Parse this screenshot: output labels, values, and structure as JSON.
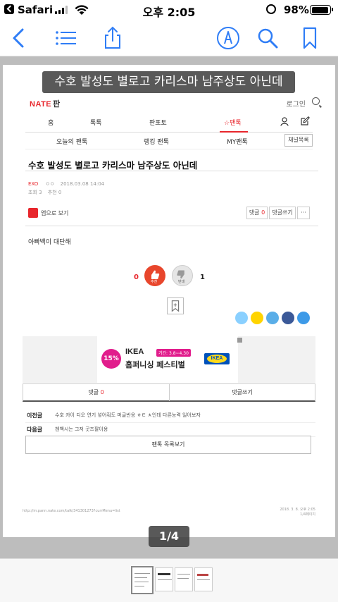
{
  "status_bar": {
    "carrier": "Safari",
    "time": "오후 2:05",
    "battery_percent": "98%",
    "signal_bars": 3
  },
  "toolbar": {
    "icons": [
      "back-icon",
      "list-icon",
      "share-icon",
      "markup-icon",
      "search-icon",
      "bookmark-icon"
    ],
    "accent_color": "#2f7df6"
  },
  "document": {
    "title_overlay": "수호 발성도 별로고 카리스마 남주상도 아닌데",
    "site": {
      "logo_brand": "NATE",
      "logo_service": "판",
      "login_label": "로그인"
    },
    "nav": {
      "items": [
        "홈",
        "톡톡",
        "판포토",
        "☆팬톡"
      ],
      "active_index": 3
    },
    "subnav": {
      "items": [
        "오늘의 팬톡",
        "랭킹 팬톡",
        "MY팬톡"
      ],
      "channel_button": "채널목록"
    },
    "post": {
      "title": "수호 발성도 별로고 카리스마 남주상도 아닌데",
      "author": "EXO",
      "meta_extra": "ㅇㅇ",
      "datetime": "2018.03.08 14:04",
      "views_label": "조회 3",
      "recommend_label": "추천 0",
      "app_view_label": "앱으로 보기",
      "comment_label": "댓글",
      "comment_count": "0",
      "write_comment_label": "댓글쓰기",
      "more_label": "···",
      "body": "아빠백이 대단해"
    },
    "votes": {
      "up_count": "0",
      "up_label": "추천",
      "down_count": "1",
      "down_label": "반대"
    },
    "share_icons": [
      "kakaostory-icon",
      "kakaotalk-icon",
      "twitter-like-icon",
      "facebook-icon",
      "twitter-icon"
    ],
    "share_colors": [
      "#8ad0ff",
      "#ffd400",
      "#5aaee8",
      "#3b5998",
      "#3d9ae8"
    ],
    "ad": {
      "discount": "15%",
      "brand": "IKEA",
      "period": "기간: 3.8~4.30",
      "headline": "홈퍼니싱 페스티벌",
      "logo_text": "IKEA"
    },
    "comment_tabs": {
      "comments_label": "댓글",
      "comments_count": "0",
      "write_label": "댓글쓰기"
    },
    "prev": {
      "label": "이전글",
      "text": "수호 카이 디오 연기 넣어줘도 머글반응 ㅎㅌ ㅊ인데 다른능력 일어보자"
    },
    "next": {
      "label": "다음글",
      "text": "첸백시는 그저 곳즈팔이용"
    },
    "list_button": "팬톡 목록보기",
    "footer_url": "http://m.pann.nate.com/talk/341301273?currMenu=list",
    "footer_date": "2018. 3. 8. 오후 2:05",
    "footer_page": "1/4페이지"
  },
  "page_indicator": "1/4",
  "thumbnails": {
    "count": 4,
    "active_index": 0
  }
}
